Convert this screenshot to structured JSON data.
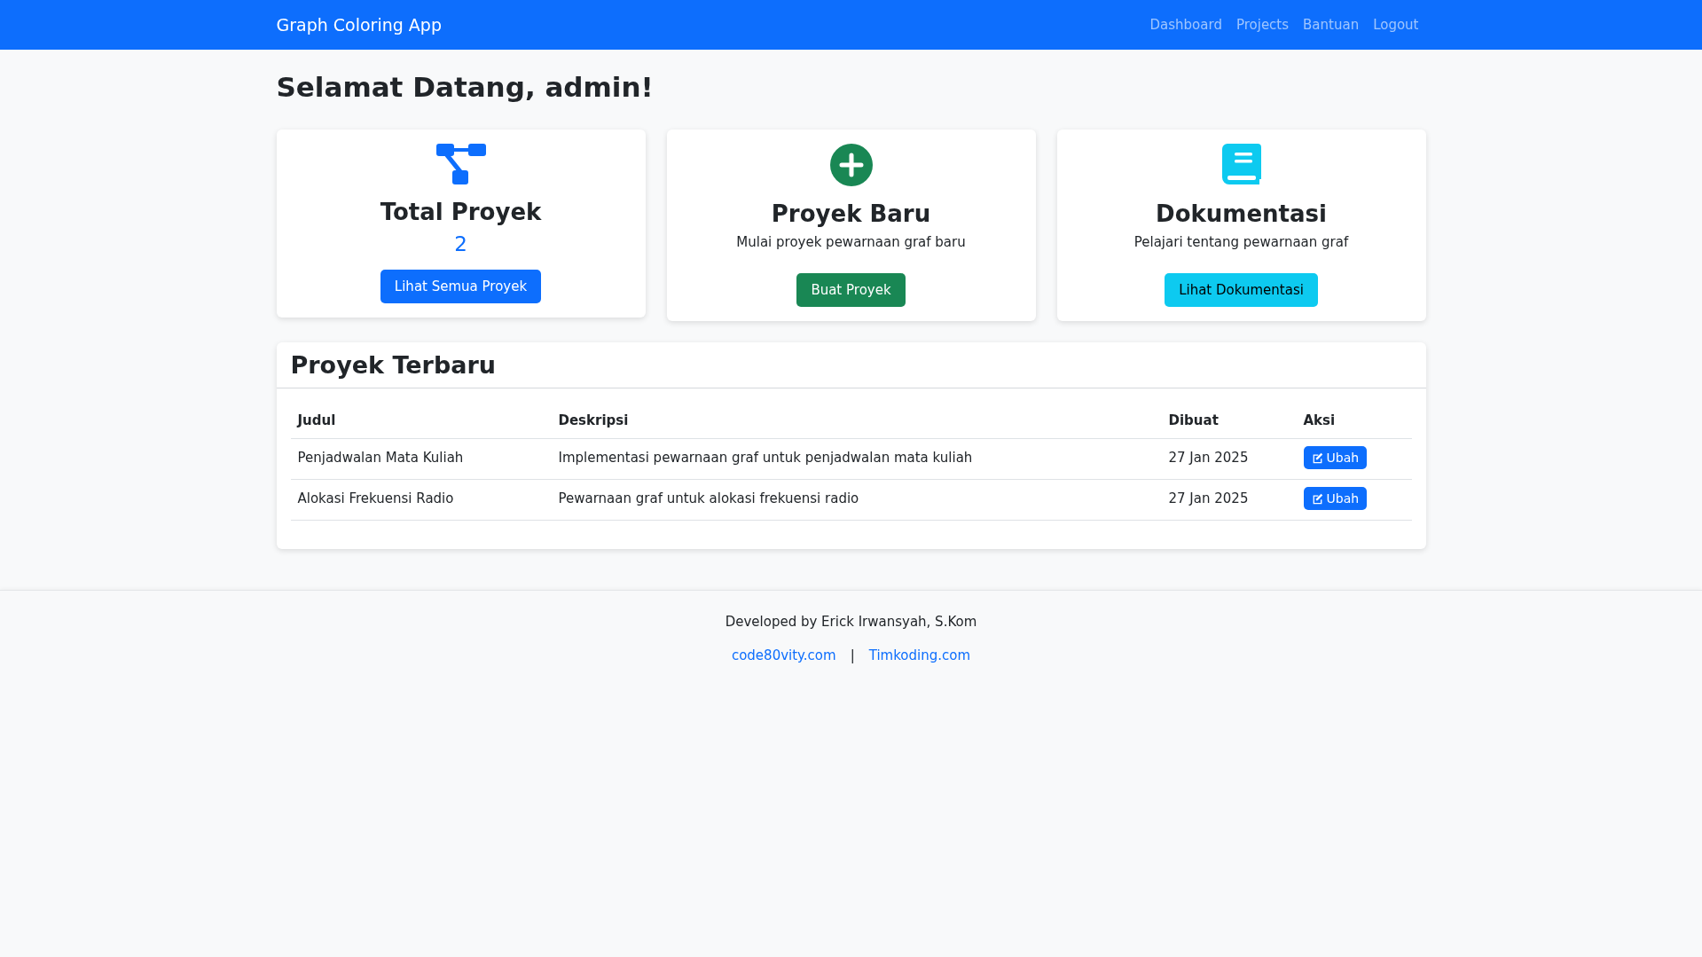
{
  "navbar": {
    "brand": "Graph Coloring App",
    "links": [
      "Dashboard",
      "Projects",
      "Bantuan",
      "Logout"
    ]
  },
  "heading": "Selamat Datang, admin!",
  "cards": [
    {
      "kind": "count",
      "title": "Total Proyek",
      "value": "2",
      "button": "Lihat Semua Proyek"
    },
    {
      "kind": "new",
      "title": "Proyek Baru",
      "description": "Mulai proyek pewarnaan graf baru",
      "button": "Buat Proyek"
    },
    {
      "kind": "docs",
      "title": "Dokumentasi",
      "description": "Pelajari tentang pewarnaan graf",
      "button": "Lihat Dokumentasi"
    }
  ],
  "recent": {
    "title": "Proyek Terbaru",
    "columns": [
      "Judul",
      "Deskripsi",
      "Dibuat",
      "Aksi"
    ],
    "rows": [
      {
        "title": "Penjadwalan Mata Kuliah",
        "description": "Implementasi pewarnaan graf untuk penjadwalan mata kuliah",
        "created": "27 Jan 2025",
        "action": "Ubah"
      },
      {
        "title": "Alokasi Frekuensi Radio",
        "description": "Pewarnaan graf untuk alokasi frekuensi radio",
        "created": "27 Jan 2025",
        "action": "Ubah"
      }
    ]
  },
  "footer": {
    "credit": "Developed by Erick Irwansyah, S.Kom",
    "links": [
      "code80vity.com",
      "Timkoding.com"
    ],
    "separator": "|"
  }
}
